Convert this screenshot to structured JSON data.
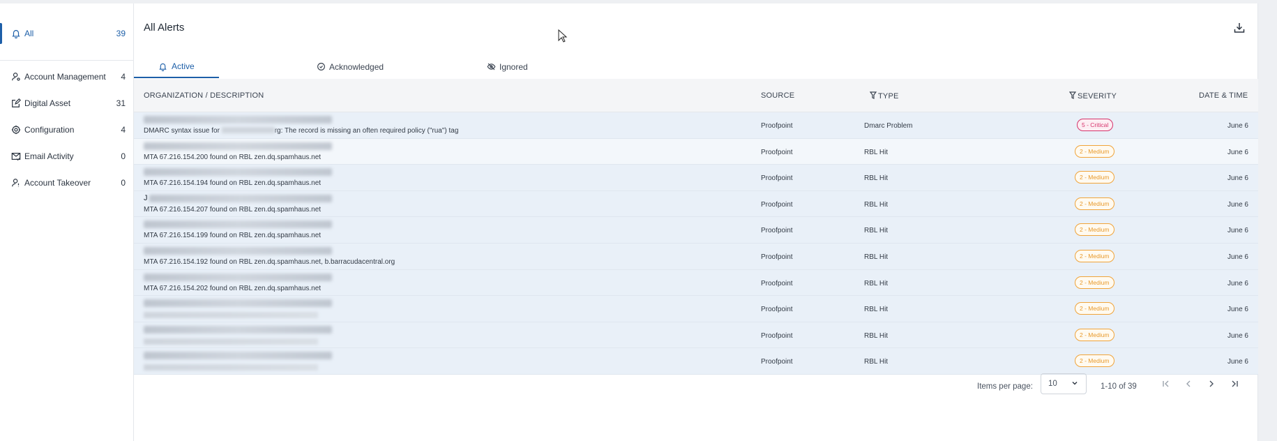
{
  "sidebar": {
    "items": [
      {
        "label": "All",
        "count": "39",
        "icon": "bell-icon"
      },
      {
        "label": "Account Management",
        "count": "4",
        "icon": "user-gear-icon"
      },
      {
        "label": "Digital Asset",
        "count": "31",
        "icon": "edit-square-icon"
      },
      {
        "label": "Configuration",
        "count": "4",
        "icon": "gear-icon"
      },
      {
        "label": "Email Activity",
        "count": "0",
        "icon": "mail-check-icon"
      },
      {
        "label": "Account Takeover",
        "count": "0",
        "icon": "user-alert-icon"
      }
    ]
  },
  "header": {
    "title": "All Alerts",
    "download_icon": "download-icon"
  },
  "tabs": [
    {
      "label": "Active",
      "icon": "bell-icon"
    },
    {
      "label": "Acknowledged",
      "icon": "check-circle-icon"
    },
    {
      "label": "Ignored",
      "icon": "eye-off-icon"
    }
  ],
  "table": {
    "headers": {
      "org": "ORGANIZATION / DESCRIPTION",
      "source": "SOURCE",
      "type": "TYPE",
      "severity": "SEVERITY",
      "date": "DATE & TIME"
    },
    "rows": [
      {
        "desc_a": "DMARC syntax issue for",
        "desc_b": "rg: The record is missing an often required policy (\"rua\") tag",
        "source": "Proofpoint",
        "type": "Dmarc Problem",
        "severity": "5 - Critical",
        "level": "critical",
        "date": "June 6"
      },
      {
        "desc": "MTA 67.216.154.200 found on RBL zen.dq.spamhaus.net",
        "source": "Proofpoint",
        "type": "RBL Hit",
        "severity": "2 - Medium",
        "level": "medium",
        "date": "June 6"
      },
      {
        "desc": "MTA 67.216.154.194 found on RBL zen.dq.spamhaus.net",
        "source": "Proofpoint",
        "type": "RBL Hit",
        "severity": "2 - Medium",
        "level": "medium",
        "date": "June 6"
      },
      {
        "prefix": "J",
        "desc": "MTA 67.216.154.207 found on RBL zen.dq.spamhaus.net",
        "source": "Proofpoint",
        "type": "RBL Hit",
        "severity": "2 - Medium",
        "level": "medium",
        "date": "June 6"
      },
      {
        "desc": "MTA 67.216.154.199 found on RBL zen.dq.spamhaus.net",
        "source": "Proofpoint",
        "type": "RBL Hit",
        "severity": "2 - Medium",
        "level": "medium",
        "date": "June 6"
      },
      {
        "desc": "MTA 67.216.154.192 found on RBL zen.dq.spamhaus.net, b.barracudacentral.org",
        "source": "Proofpoint",
        "type": "RBL Hit",
        "severity": "2 - Medium",
        "level": "medium",
        "date": "June 6"
      },
      {
        "desc": "MTA 67.216.154.202 found on RBL zen.dq.spamhaus.net",
        "source": "Proofpoint",
        "type": "RBL Hit",
        "severity": "2 - Medium",
        "level": "medium",
        "date": "June 6"
      },
      {
        "desc": "",
        "source": "Proofpoint",
        "type": "RBL Hit",
        "severity": "2 - Medium",
        "level": "medium",
        "date": "June 6"
      },
      {
        "desc": "",
        "source": "Proofpoint",
        "type": "RBL Hit",
        "severity": "2 - Medium",
        "level": "medium",
        "date": "June 6"
      },
      {
        "desc": "",
        "source": "Proofpoint",
        "type": "RBL Hit",
        "severity": "2 - Medium",
        "level": "medium",
        "date": "June 6"
      }
    ]
  },
  "pager": {
    "items_per_page_label": "Items per page:",
    "items_per_page": "10",
    "range": "1-10 of 39"
  },
  "colors": {
    "accent": "#1d5fa8",
    "critical": "#d6336c",
    "medium": "#f0a43a"
  }
}
